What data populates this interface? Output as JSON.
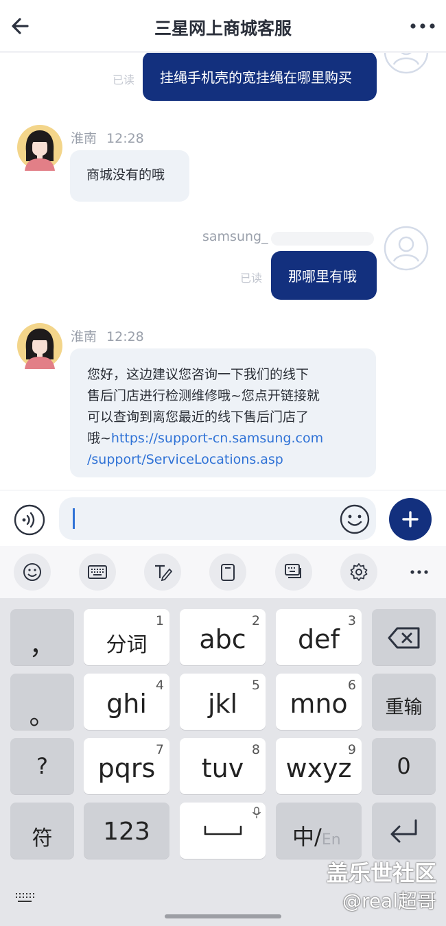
{
  "header": {
    "title": "三星网上商城客服"
  },
  "chat": {
    "messages": [
      {
        "direction": "out",
        "read_status": "已读",
        "text": "挂绳手机壳的宽挂绳在哪里购买"
      },
      {
        "direction": "in",
        "sender": "淮南",
        "time": "12:28",
        "text": "商城没有的哦"
      },
      {
        "direction": "out",
        "sender": "samsung_",
        "read_status": "已读",
        "text": "那哪里有哦"
      },
      {
        "direction": "in",
        "sender": "淮南",
        "time": "12:28",
        "lines": [
          "您好，这边建议您咨询一下我们的线下",
          "售后门店进行检测维修哦~您点开链接就",
          "可以查询到离您最近的线下售后门店了"
        ],
        "link_prefix": "哦~",
        "link_line1": "https://support-cn.samsung.com",
        "link_line2": "/support/ServiceLocations.asp"
      }
    ]
  },
  "input": {
    "value": ""
  },
  "toolbar": {
    "icons": [
      "emoji-icon",
      "keyboard-icon",
      "handwriting-icon",
      "clipboard-icon",
      "one-handed-keyboard-icon",
      "settings-icon",
      "more-icon"
    ]
  },
  "keyboard": {
    "keys": [
      {
        "label": "，"
      },
      {
        "label": "分词",
        "num": "1"
      },
      {
        "label": "abc",
        "num": "2"
      },
      {
        "label": "def",
        "num": "3"
      },
      {
        "label": "。"
      },
      {
        "label": "ghi",
        "num": "4"
      },
      {
        "label": "jkl",
        "num": "5"
      },
      {
        "label": "mno",
        "num": "6"
      },
      {
        "label": "重输"
      },
      {
        "label": "?"
      },
      {
        "label": "pqrs",
        "num": "7"
      },
      {
        "label": "tuv",
        "num": "8"
      },
      {
        "label": "wxyz",
        "num": "9"
      },
      {
        "label": "0"
      },
      {
        "label": "符"
      },
      {
        "label": "123"
      },
      {
        "label": "中/",
        "sub": "En"
      }
    ]
  },
  "watermark": {
    "line1": "盖乐世社区",
    "line2": "@real超哥"
  },
  "colors": {
    "accent": "#13307e",
    "link": "#2f72d6",
    "incoming_bubble": "#eef2f7"
  }
}
